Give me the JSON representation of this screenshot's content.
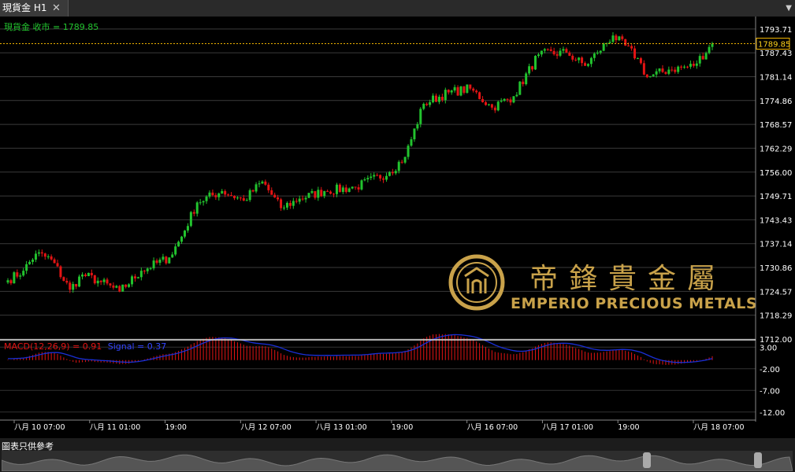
{
  "window": {
    "tab_label": "現貨金 H1",
    "close_glyph": "✕",
    "menu_glyph": "▼"
  },
  "chart_data": [
    {
      "type": "candlestick",
      "title": "現貨金 收市 = 1789.85",
      "symbol": "現貨金",
      "timeframe": "H1",
      "last_close": 1789.85,
      "last_close_label": "1789.85",
      "ylim": [
        1712.0,
        1797.0
      ],
      "y_ticks": [
        "1793.71",
        "1787.43",
        "1781.14",
        "1774.86",
        "1768.57",
        "1762.29",
        "1756.00",
        "1749.71",
        "1743.43",
        "1737.14",
        "1730.86",
        "1724.57",
        "1718.29",
        "1712.00"
      ],
      "x_ticks": [
        "八月 10 07:00",
        "八月 11 01:00",
        "19:00",
        "八月 12 07:00",
        "八月 13 01:00",
        "19:00",
        "八月 16 07:00",
        "八月 17 01:00",
        "19:00",
        "八月 18 07:00"
      ],
      "candle_anchors": [
        [
          0,
          1727.5
        ],
        [
          5,
          1730
        ],
        [
          9,
          1734.5
        ],
        [
          14,
          1733
        ],
        [
          20,
          1725
        ],
        [
          24,
          1729
        ],
        [
          30,
          1727
        ],
        [
          36,
          1724.5
        ],
        [
          43,
          1730
        ],
        [
          52,
          1733.5
        ],
        [
          56,
          1739
        ],
        [
          61,
          1748
        ],
        [
          69,
          1751
        ],
        [
          76,
          1748.5
        ],
        [
          82,
          1753.5
        ],
        [
          88,
          1746.5
        ],
        [
          94,
          1749
        ],
        [
          102,
          1751
        ],
        [
          112,
          1752
        ],
        [
          123,
          1756
        ],
        [
          128,
          1760
        ],
        [
          134,
          1774
        ],
        [
          142,
          1777
        ],
        [
          149,
          1778
        ],
        [
          156,
          1773
        ],
        [
          163,
          1776
        ],
        [
          171,
          1787
        ],
        [
          180,
          1787.5
        ],
        [
          186,
          1784
        ],
        [
          190,
          1787.5
        ],
        [
          195,
          1792
        ],
        [
          203,
          1786
        ],
        [
          206,
          1781
        ],
        [
          213,
          1783
        ],
        [
          221,
          1784
        ],
        [
          227,
          1789.85
        ]
      ],
      "colors": {
        "up": "#22c32e",
        "down": "#e41414",
        "last_price_line": "#f0b400"
      }
    },
    {
      "type": "macd",
      "title": "MACD(12,26,9) = 0.91",
      "signal_label": "Signal = 0.37",
      "params": [
        12,
        26,
        9
      ],
      "macd_value": 0.91,
      "signal_value": 0.37,
      "ylim": [
        -13.5,
        4.5
      ],
      "y_ticks": [
        "3.00",
        "-2.00",
        "-7.00",
        "-12.00"
      ],
      "colors": {
        "histogram": "#e41414",
        "signal": "#1a2fd6",
        "title": "#e41414",
        "signal_title": "#1a2fd6"
      }
    }
  ],
  "watermark": {
    "chinese_name": "帝鋒貴金屬",
    "english_name": "EMPERIO PRECIOUS METALS",
    "color": "#c9a24a"
  },
  "footer": {
    "disclaimer": "圖表只供參考"
  }
}
